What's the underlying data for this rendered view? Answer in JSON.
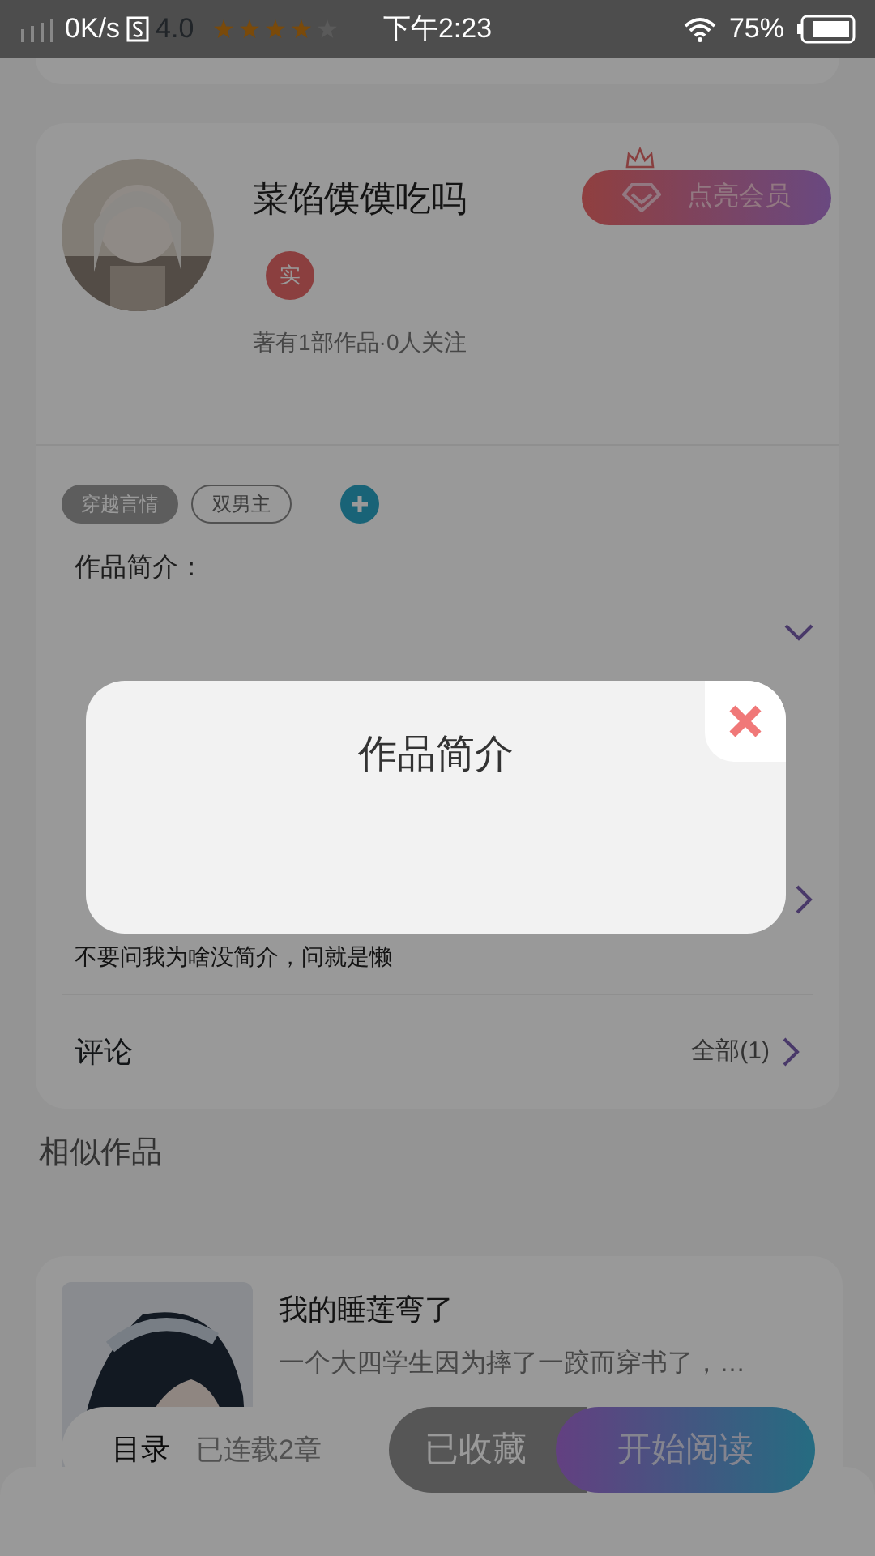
{
  "status_bar": {
    "network_speed": "0K/s",
    "rating": "4.0",
    "stars": 4,
    "time": "下午2:23",
    "battery": "75%"
  },
  "author": {
    "name": "菜馅馍馍吃吗",
    "verified_badge": "实",
    "stats": "著有1部作品·0人关注",
    "member_button": "点亮会员"
  },
  "tags": [
    {
      "label": "穿越言情",
      "kind": "filled"
    },
    {
      "label": "双男主",
      "kind": "outline"
    }
  ],
  "intro": {
    "heading": "作品简介：",
    "text": "不要问我为啥没简介，问就是懒"
  },
  "comments": {
    "label": "评论",
    "link": "全部(1)"
  },
  "similar": {
    "heading": "相似作品",
    "books": [
      {
        "title": "我的睡莲弯了",
        "description": "一个大四学生因为摔了一跤而穿书了，…"
      }
    ]
  },
  "bottom_bar": {
    "catalog": "目录",
    "chapters": "已连载2章",
    "collect_button": "已收藏",
    "collected": true,
    "read_button": "开始阅读"
  },
  "dialog": {
    "title": "作品简介"
  }
}
